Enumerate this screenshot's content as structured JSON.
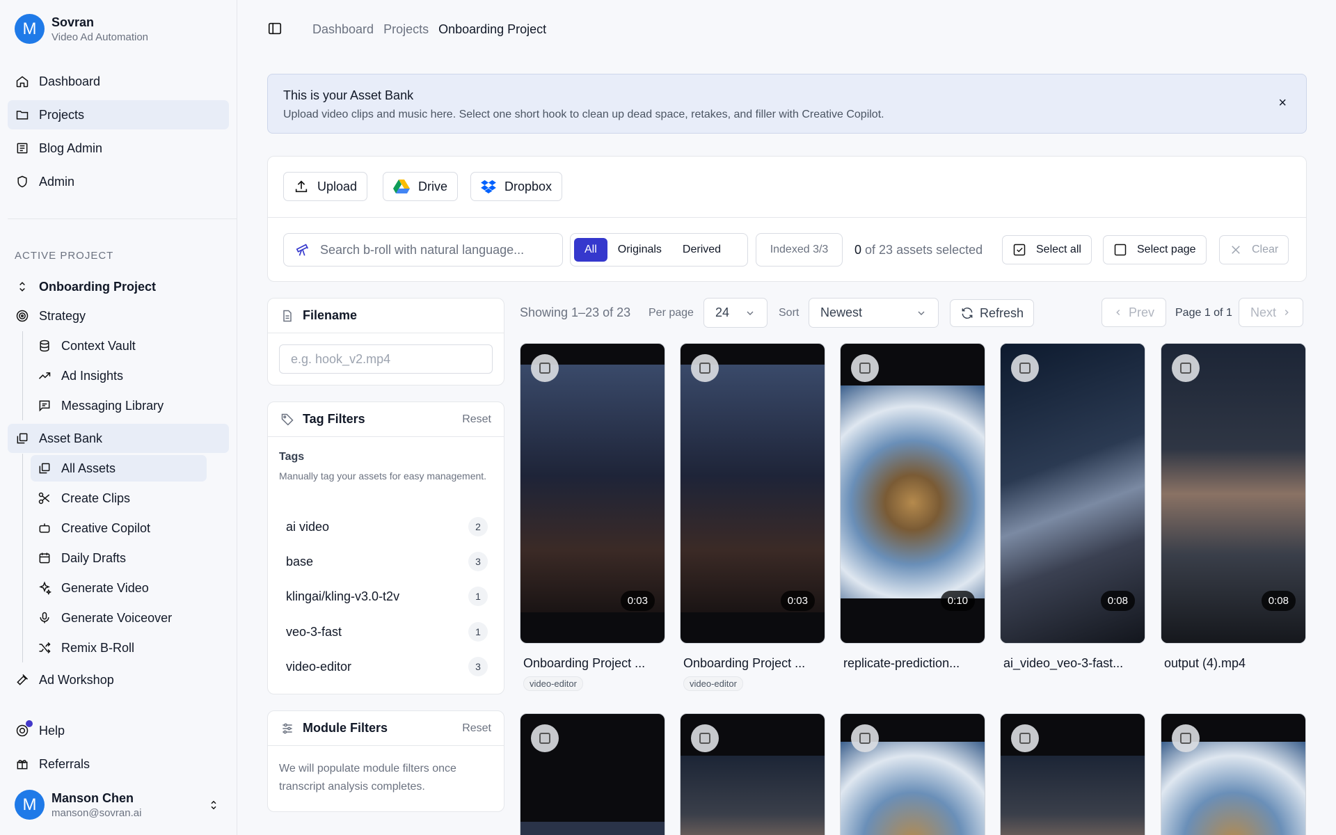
{
  "brand": {
    "avatar_letter": "M",
    "name": "Sovran",
    "subtitle": "Video Ad Automation"
  },
  "nav": {
    "main": [
      {
        "label": "Dashboard",
        "icon": "home-icon"
      },
      {
        "label": "Projects",
        "icon": "folder-icon",
        "active": true
      },
      {
        "label": "Blog Admin",
        "icon": "newspaper-icon"
      },
      {
        "label": "Admin",
        "icon": "shield-icon"
      }
    ],
    "section_label": "ACTIVE PROJECT",
    "project_name": "Onboarding Project",
    "strategy": "Strategy",
    "strategy_items": [
      "Context Vault",
      "Ad Insights",
      "Messaging Library"
    ],
    "asset_bank": "Asset Bank",
    "asset_items": [
      "All Assets",
      "Create Clips",
      "Creative Copilot",
      "Daily Drafts",
      "Generate Video",
      "Generate Voiceover",
      "Remix B-Roll"
    ],
    "ad_workshop": "Ad Workshop",
    "help": "Help",
    "referrals": "Referrals"
  },
  "user": {
    "avatar_letter": "M",
    "name": "Manson Chen",
    "email": "manson@sovran.ai"
  },
  "breadcrumb": [
    "Dashboard",
    "Projects",
    "Onboarding Project"
  ],
  "banner": {
    "title": "This is your Asset Bank",
    "text": "Upload video clips and music here. Select one short hook to clean up dead space, retakes, and filler with Creative Copilot.",
    "close": "×"
  },
  "toolbar": {
    "upload": "Upload",
    "drive": "Drive",
    "dropbox": "Dropbox",
    "search_placeholder": "Search b-roll with natural language...",
    "segments": [
      "All",
      "Originals",
      "Derived"
    ],
    "indexed": "Indexed 3/3",
    "selected_count": "0",
    "selected_text": "of 23 assets selected",
    "select_all": "Select all",
    "select_page": "Select page",
    "clear": "Clear"
  },
  "filters": {
    "filename_title": "Filename",
    "filename_placeholder": "e.g. hook_v2.mp4",
    "tag_title": "Tag Filters",
    "reset": "Reset",
    "tags_heading": "Tags",
    "tags_desc": "Manually tag your assets for easy management.",
    "tags": [
      {
        "name": "ai video",
        "count": "2"
      },
      {
        "name": "base",
        "count": "3"
      },
      {
        "name": "klingai/kling-v3.0-t2v",
        "count": "1"
      },
      {
        "name": "veo-3-fast",
        "count": "1"
      },
      {
        "name": "video-editor",
        "count": "3"
      }
    ],
    "module_title": "Module Filters",
    "module_text": "We will populate module filters once transcript analysis completes."
  },
  "results": {
    "showing": "Showing 1–23 of 23",
    "per_page_label": "Per page",
    "per_page": "24",
    "sort_label": "Sort",
    "sort": "Newest",
    "refresh": "Refresh",
    "prev": "Prev",
    "page_info": "Page 1 of 1",
    "next": "Next"
  },
  "assets": [
    {
      "title": "Onboarding Project ...",
      "duration": "0:03",
      "tag": "video-editor"
    },
    {
      "title": "Onboarding Project ...",
      "duration": "0:03",
      "tag": "video-editor"
    },
    {
      "title": "replicate-prediction...",
      "duration": "0:10",
      "tag": ""
    },
    {
      "title": "ai_video_veo-3-fast...",
      "duration": "0:08",
      "tag": ""
    },
    {
      "title": "output (4).mp4",
      "duration": "0:08",
      "tag": ""
    }
  ],
  "colors": {
    "accent": "#3538cd",
    "avatar": "#1f7ae8",
    "active_nav": "#e8edf7"
  }
}
